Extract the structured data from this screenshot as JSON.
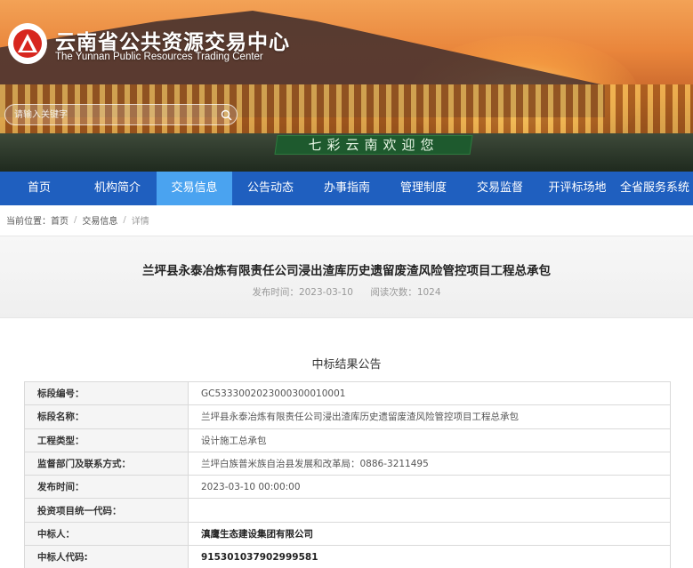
{
  "site": {
    "title": "云南省公共资源交易中心",
    "subtitle": "The Yunnan Public Resources Trading Center",
    "banner_sign": "七彩云南欢迎您"
  },
  "search": {
    "placeholder": "请输入关键字"
  },
  "nav": {
    "items": [
      {
        "label": "首页"
      },
      {
        "label": "机构简介"
      },
      {
        "label": "交易信息"
      },
      {
        "label": "公告动态"
      },
      {
        "label": "办事指南"
      },
      {
        "label": "管理制度"
      },
      {
        "label": "交易监督"
      },
      {
        "label": "开评标场地"
      },
      {
        "label": "全省服务系统"
      }
    ],
    "active_index": 2
  },
  "breadcrumb": {
    "prefix": "当前位置：",
    "home": "首页",
    "section": "交易信息",
    "current": "详情"
  },
  "article": {
    "title": "兰坪县永泰冶炼有限责任公司浸出渣库历史遗留废渣风险管控项目工程总承包",
    "publish_label": "发布时间：",
    "publish_date": "2023-03-10",
    "views_label": "阅读次数：",
    "views": "1024"
  },
  "notice": {
    "heading": "中标结果公告",
    "rows": [
      {
        "key": "标段编号：",
        "value": "GC5333002023000300010001"
      },
      {
        "key": "标段名称：",
        "value": "兰坪县永泰冶炼有限责任公司浸出渣库历史遗留废渣风险管控项目工程总承包"
      },
      {
        "key": "工程类型：",
        "value": "设计施工总承包"
      },
      {
        "key": "监督部门及联系方式：",
        "value": "兰坪白族普米族自治县发展和改革局：0886-3211495"
      },
      {
        "key": "发布时间：",
        "value": "2023-03-10 00:00:00"
      },
      {
        "key": "投资项目统一代码：",
        "value": ""
      },
      {
        "key": "中标人：",
        "value": "滇鹰生态建设集团有限公司"
      },
      {
        "key": "中标人代码:",
        "value": "915301037902999581"
      }
    ]
  },
  "colors": {
    "nav_bg": "#1f5fbf",
    "nav_active": "#4aa3f0",
    "logo_red": "#d7261e"
  },
  "icons": {
    "logo": "triangle-logo-icon",
    "search": "search-icon"
  }
}
